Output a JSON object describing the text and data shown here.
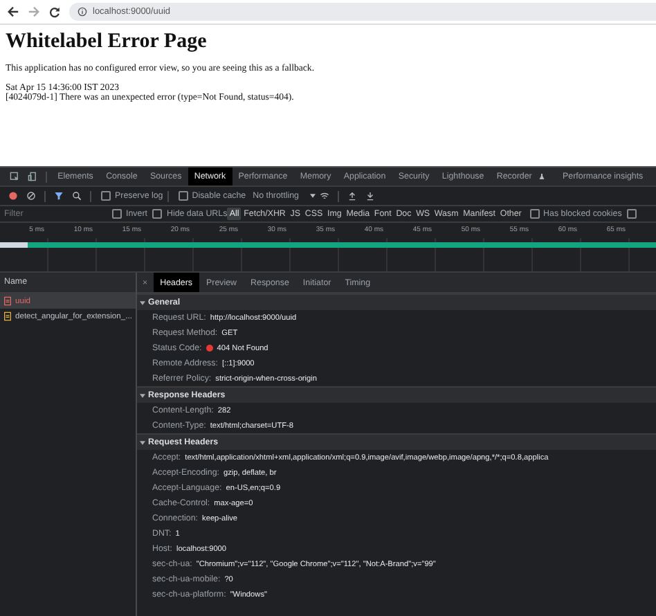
{
  "browser": {
    "url": "localhost:9000/uuid"
  },
  "page": {
    "heading": "Whitelabel Error Page",
    "message": "This application has no configured error view, so you are seeing this as a fallback.",
    "timestamp": "Sat Apr 15 14:36:00 IST 2023",
    "error": "[4024079d-1] There was an unexpected error (type=Not Found, status=404)."
  },
  "devtools": {
    "tabs": [
      {
        "label": "Elements",
        "selected": false
      },
      {
        "label": "Console",
        "selected": false
      },
      {
        "label": "Sources",
        "selected": false
      },
      {
        "label": "Network",
        "selected": true
      },
      {
        "label": "Performance",
        "selected": false
      },
      {
        "label": "Memory",
        "selected": false
      },
      {
        "label": "Application",
        "selected": false
      },
      {
        "label": "Security",
        "selected": false
      },
      {
        "label": "Lighthouse",
        "selected": false
      },
      {
        "label": "Recorder",
        "selected": false
      },
      {
        "label": "Performance insights",
        "selected": false
      }
    ],
    "toolbar": {
      "recording": true,
      "filter_active": true,
      "preserve_log": {
        "label": "Preserve log",
        "checked": false
      },
      "disable_cache": {
        "label": "Disable cache",
        "checked": false
      },
      "throttling": "No throttling"
    },
    "filter": {
      "placeholder": "Filter",
      "invert": {
        "label": "Invert",
        "checked": false
      },
      "hide_data_urls": {
        "label": "Hide data URLs",
        "checked": false
      },
      "types": [
        {
          "label": "All",
          "selected": true
        },
        {
          "label": "Fetch/XHR",
          "selected": false
        },
        {
          "label": "JS",
          "selected": false
        },
        {
          "label": "CSS",
          "selected": false
        },
        {
          "label": "Img",
          "selected": false
        },
        {
          "label": "Media",
          "selected": false
        },
        {
          "label": "Font",
          "selected": false
        },
        {
          "label": "Doc",
          "selected": false
        },
        {
          "label": "WS",
          "selected": false
        },
        {
          "label": "Wasm",
          "selected": false
        },
        {
          "label": "Manifest",
          "selected": false
        },
        {
          "label": "Other",
          "selected": false
        }
      ],
      "blocked_cookies": {
        "label": "Has blocked cookies",
        "checked": false
      },
      "unlabelled_checkbox": {
        "checked": false
      }
    },
    "timeline_ticks": [
      "5 ms",
      "10 ms",
      "15 ms",
      "20 ms",
      "25 ms",
      "30 ms",
      "35 ms",
      "40 ms",
      "45 ms",
      "50 ms",
      "55 ms",
      "60 ms",
      "65 ms"
    ],
    "requests": {
      "column": "Name",
      "rows": [
        {
          "name": "uuid",
          "failed": true,
          "selected": true
        },
        {
          "name": "detect_angular_for_extension_...",
          "failed": false,
          "selected": false
        }
      ]
    },
    "detail_close": "×",
    "detail_tabs": [
      {
        "label": "Headers",
        "selected": true
      },
      {
        "label": "Preview",
        "selected": false
      },
      {
        "label": "Response",
        "selected": false
      },
      {
        "label": "Initiator",
        "selected": false
      },
      {
        "label": "Timing",
        "selected": false
      }
    ],
    "sections": [
      {
        "title": "General",
        "expanded": true,
        "rows": [
          {
            "name": "Request URL:",
            "value": "http://localhost:9000/uuid"
          },
          {
            "name": "Request Method:",
            "value": "GET"
          },
          {
            "name": "Status Code:",
            "value": "404 Not Found",
            "status_failed": true
          },
          {
            "name": "Remote Address:",
            "value": "[::1]:9000"
          },
          {
            "name": "Referrer Policy:",
            "value": "strict-origin-when-cross-origin"
          }
        ]
      },
      {
        "title": "Response Headers",
        "expanded": true,
        "rows": [
          {
            "name": "Content-Length:",
            "value": "282"
          },
          {
            "name": "Content-Type:",
            "value": "text/html;charset=UTF-8"
          }
        ]
      },
      {
        "title": "Request Headers",
        "expanded": true,
        "rows": [
          {
            "name": "Accept:",
            "value": "text/html,application/xhtml+xml,application/xml;q=0.9,image/avif,image/webp,image/apng,*/*;q=0.8,applica"
          },
          {
            "name": "Accept-Encoding:",
            "value": "gzip, deflate, br"
          },
          {
            "name": "Accept-Language:",
            "value": "en-US,en;q=0.9"
          },
          {
            "name": "Cache-Control:",
            "value": "max-age=0"
          },
          {
            "name": "Connection:",
            "value": "keep-alive"
          },
          {
            "name": "DNT:",
            "value": "1"
          },
          {
            "name": "Host:",
            "value": "localhost:9000"
          },
          {
            "name": "sec-ch-ua:",
            "value": "\"Chromium\";v=\"112\", \"Google Chrome\";v=\"112\", \"Not:A-Brand\";v=\"99\""
          },
          {
            "name": "sec-ch-ua-mobile:",
            "value": "?0"
          },
          {
            "name": "sec-ch-ua-platform:",
            "value": "\"Windows\""
          }
        ]
      }
    ]
  }
}
